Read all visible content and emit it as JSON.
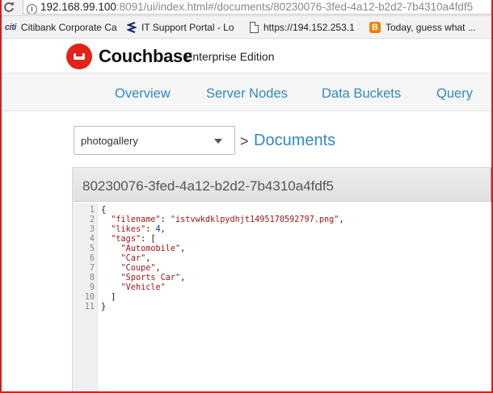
{
  "browser": {
    "url_host": "192.168.99.100",
    "url_rest": ":8091/ui/index.html#/documents/80230076-3fed-4a12-b2d2-7b4310a4fdf5",
    "bookmarks": [
      {
        "label": "Citibank Corporate Ca",
        "icon": "citi-icon"
      },
      {
        "label": "IT Support Portal - Lo",
        "icon": "servicenow-icon"
      },
      {
        "label": "https://194.152.253.1",
        "icon": "page-icon"
      },
      {
        "label": "Today, guess what ...",
        "icon": "blogger-icon"
      }
    ]
  },
  "header": {
    "brand": "Couchbase",
    "edition": "Enterprise Edition",
    "logo_color": "#e2231a"
  },
  "nav": {
    "items": [
      "Overview",
      "Server Nodes",
      "Data Buckets",
      "Query"
    ],
    "link_color": "#2e8ac6"
  },
  "content": {
    "bucket": "photogallery",
    "breadcrumb_sep": ">",
    "breadcrumb_title": "Documents"
  },
  "document": {
    "id": "80230076-3fed-4a12-b2d2-7b4310a4fdf5",
    "lines": [
      {
        "num": "1",
        "text": "{"
      },
      {
        "num": "2",
        "text": "  \"filename\": \"istvwkdklpydhjt1495170592797.png\","
      },
      {
        "num": "3",
        "text": "  \"likes\": 4,"
      },
      {
        "num": "4",
        "text": "  \"tags\": ["
      },
      {
        "num": "5",
        "text": "    \"Automobile\","
      },
      {
        "num": "6",
        "text": "    \"Car\","
      },
      {
        "num": "7",
        "text": "    \"Coupe\","
      },
      {
        "num": "8",
        "text": "    \"Sports Car\","
      },
      {
        "num": "9",
        "text": "    \"Vehicle\""
      },
      {
        "num": "10",
        "text": "  ]"
      },
      {
        "num": "11",
        "text": "}"
      }
    ]
  }
}
